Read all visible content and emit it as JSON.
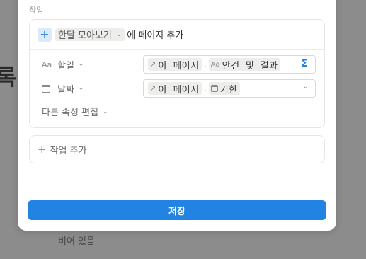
{
  "background": {
    "title_fragment": "록",
    "empty_text": "비어 있음"
  },
  "modal": {
    "section_label": "작업",
    "trigger": {
      "plus_icon": "plus-icon",
      "database": "한달 모아보기",
      "suffix": "에 페이지 추가"
    },
    "properties": [
      {
        "label": "할일",
        "icon": "text-aa-icon",
        "icon_glyph": "Aa",
        "tokens": [
          {
            "icon": "↗",
            "text": "이 페이지"
          },
          {
            "icon": "Aa",
            "text": "안건 및 결과"
          }
        ],
        "trailing": "Σ"
      },
      {
        "label": "날짜",
        "icon": "calendar-icon",
        "tokens": [
          {
            "icon": "↗",
            "text": "이 페이지"
          },
          {
            "icon": "calendar",
            "text": "기한"
          }
        ],
        "trailing": "chevron-down-icon"
      }
    ],
    "edit_props_label": "다른 속성 편집",
    "add_action_label": "작업 추가",
    "save_label": "저장"
  },
  "colors": {
    "accent": "#2383e2",
    "overlay": "#8c8c8c",
    "chip_bg": "#ededec"
  }
}
